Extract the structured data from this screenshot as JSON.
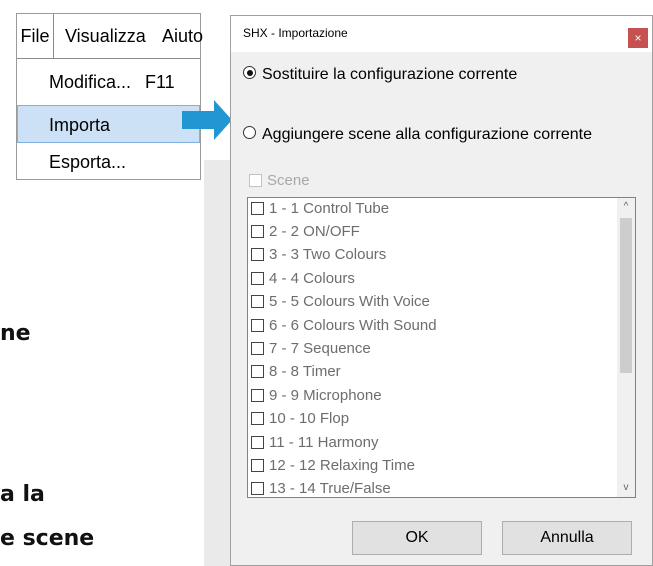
{
  "background_text": [
    "ne",
    "a la",
    "e scene"
  ],
  "menu": {
    "bar": [
      "File",
      "Visualizza",
      "Aiuto"
    ],
    "items": [
      {
        "label": "Modifica...",
        "shortcut": "F11",
        "selected": false
      },
      {
        "label": "Importa",
        "shortcut": "",
        "selected": true
      },
      {
        "label": "Esporta...",
        "shortcut": "",
        "selected": false
      }
    ]
  },
  "dialog": {
    "title": "SHX - Importazione",
    "close_icon": "×",
    "options": [
      {
        "label": "Sostituire la configurazione corrente",
        "selected": true
      },
      {
        "label": "Aggiungere scene alla configurazione corrente",
        "selected": false
      }
    ],
    "scenes_label": "Scene",
    "scenes": [
      "1 - 1 Control Tube",
      "2 - 2 ON/OFF",
      "3 - 3 Two Colours",
      "4 - 4 Colours",
      "5 - 5 Colours With Voice",
      "6 - 6 Colours With Sound",
      "7 - 7 Sequence",
      "8 - 8 Timer",
      "9 - 9 Microphone",
      "10 - 10 Flop",
      "11 - 11 Harmony",
      "12 - 12 Relaxing Time",
      "13 - 14 True/False"
    ],
    "scroll_up_icon": "^",
    "scroll_down_icon": "v",
    "ok_label": "OK",
    "cancel_label": "Annulla"
  },
  "colors": {
    "arrow": "#2196d3",
    "selection": "#cce1f6",
    "close": "#c75050"
  }
}
